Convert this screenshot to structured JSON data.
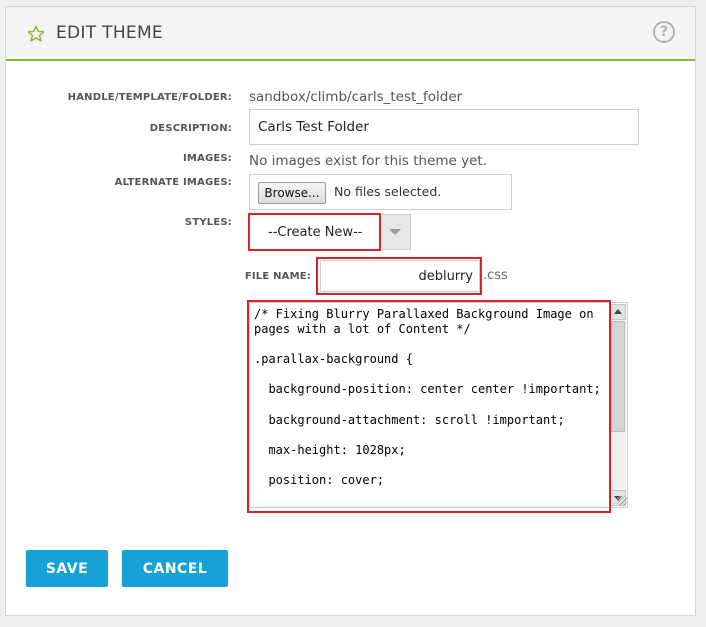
{
  "header": {
    "title": "EDIT THEME",
    "icon": "star-icon",
    "help_icon": "help-icon",
    "help_symbol": "?",
    "accent_color": "#8fb43a"
  },
  "form": {
    "handle": {
      "label": "HANDLE/TEMPLATE/FOLDER:",
      "value": "sandbox/climb/carls_test_folder"
    },
    "description": {
      "label": "DESCRIPTION:",
      "value": "Carls Test Folder"
    },
    "images": {
      "label": "IMAGES:",
      "value": "No images exist for this theme yet."
    },
    "alternate_images": {
      "label": "ALTERNATE IMAGES:",
      "browse_label": "Browse...",
      "status": "No files selected."
    },
    "styles": {
      "label": "STYLES:",
      "selected": "--Create New--"
    },
    "file_name": {
      "label": "FILE NAME:",
      "value": "deblurry",
      "extension": ".css",
      "content": "/* Fixing Blurry Parallaxed Background Image on pages with a lot of Content */\n\n.parallax-background {\n\n  background-position: center center !important;\n\n  background-attachment: scroll !important;\n\n  max-height: 1028px;\n\n  position: cover;"
    }
  },
  "actions": {
    "save_label": "SAVE",
    "cancel_label": "CANCEL",
    "button_color": "#16a2d6"
  },
  "highlight_color": "#d8222c"
}
